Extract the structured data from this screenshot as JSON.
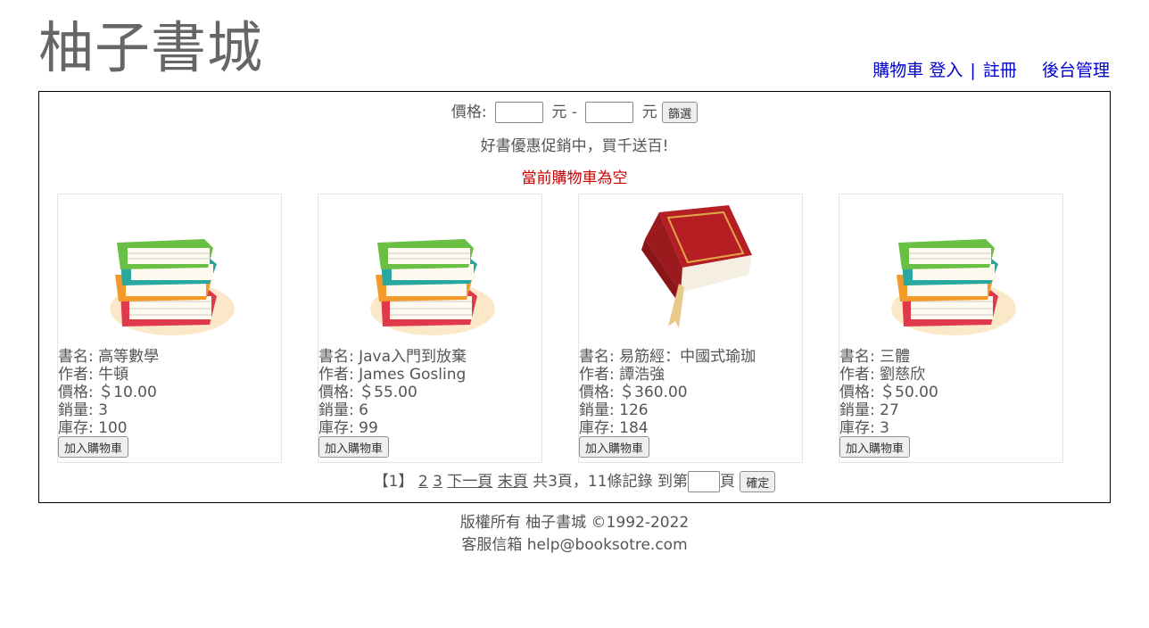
{
  "header": {
    "logo": "柚子書城",
    "nav": {
      "cart": "購物車",
      "login": "登入",
      "sep": "|",
      "register": "註冊",
      "admin": "後台管理"
    }
  },
  "filter": {
    "label": "價格:",
    "unit1": "元 -",
    "unit2": "元",
    "min_value": "",
    "max_value": "",
    "button": "篩選"
  },
  "promo": "好書優惠促銷中，買千送百!",
  "cart_status": "當前購物車為空",
  "books": [
    {
      "name": "書名: 高等數學",
      "author": "作者: 牛頓",
      "price": "價格: ＄10.00",
      "sales": "銷量: 3",
      "stock": "庫存: 100",
      "button": "加入購物車",
      "cover": "books-stack-icon"
    },
    {
      "name": "書名: Java入門到放棄",
      "author": "作者: James Gosling",
      "price": "價格: ＄55.00",
      "sales": "銷量: 6",
      "stock": "庫存: 99",
      "button": "加入購物車",
      "cover": "books-stack-icon"
    },
    {
      "name": "書名: 易筋經：中國式瑜珈",
      "author": "作者: 譚浩強",
      "price": "價格: ＄360.00",
      "sales": "銷量: 126",
      "stock": "庫存: 184",
      "button": "加入購物車",
      "cover": "red-book-icon"
    },
    {
      "name": "書名: 三體",
      "author": "作者: 劉慈欣",
      "price": "價格: ＄50.00",
      "sales": "銷量: 27",
      "stock": "庫存: 3",
      "button": "加入購物車",
      "cover": "books-stack-icon"
    }
  ],
  "pager": {
    "current": "【1】",
    "page2": "2",
    "page3": "3",
    "next": "下一頁",
    "last": "末頁",
    "summary": "共3頁，11條記錄 到第",
    "goto_value": "",
    "page_suffix": "頁",
    "button": "確定"
  },
  "footer": {
    "copyright": "版權所有 柚子書城 ©1992-2022",
    "contact": "客服信箱 help@booksotre.com"
  }
}
